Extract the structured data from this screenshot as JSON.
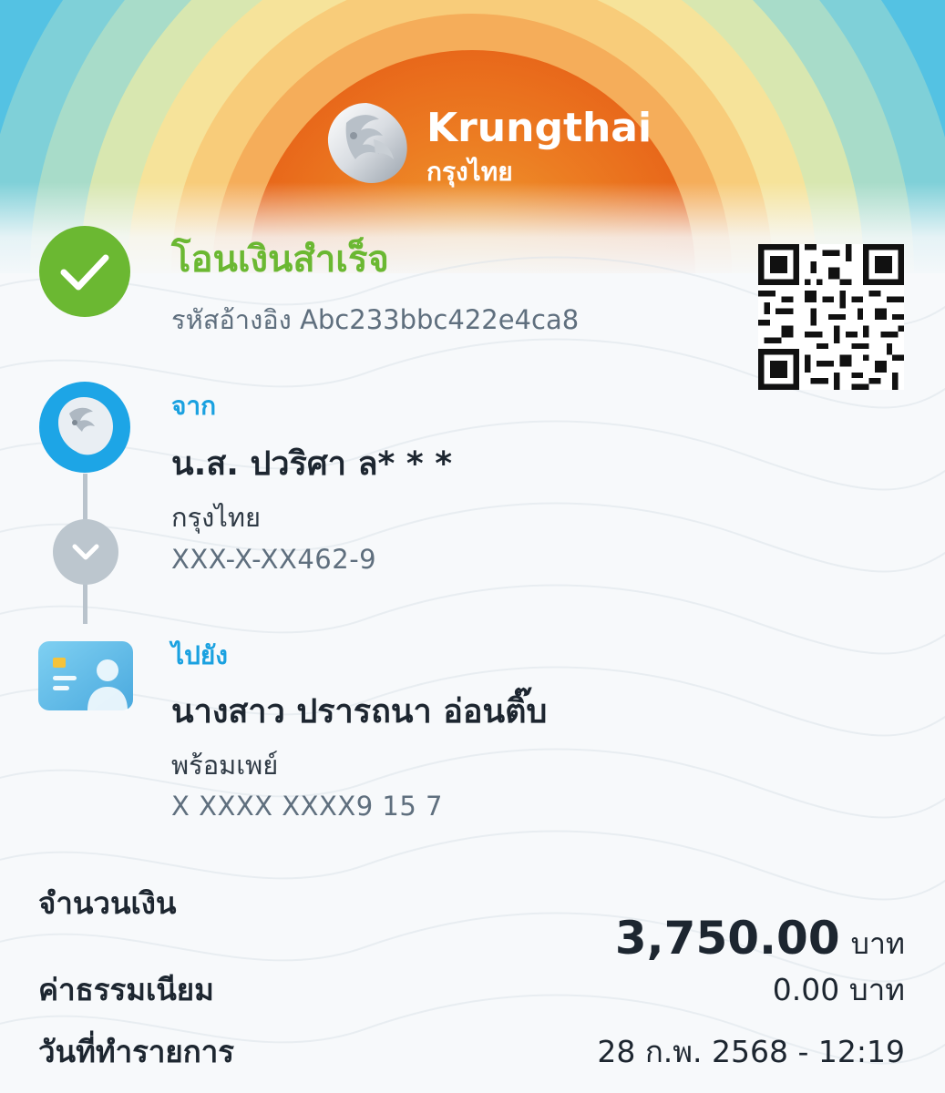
{
  "brand": {
    "name": "Krungthai",
    "thai_name": "กรุงไทย"
  },
  "status": {
    "title": "โอนเงินสำเร็จ",
    "ref_label": "รหัสอ้างอิง",
    "ref_code": "Abc233bbc422e4ca8"
  },
  "from": {
    "label": "จาก",
    "name": "น.ส. ปวริศา ล* * *",
    "bank": "กรุงไทย",
    "account": "XXX-X-XX462-9"
  },
  "to": {
    "label": "ไปยัง",
    "name": "นางสาว ปรารถนา อ่อนติ๊บ",
    "service": "พร้อมเพย์",
    "account": "X XXXX XXXX9 15 7"
  },
  "summary": {
    "amount_label": "จำนวนเงิน",
    "amount_value": "3,750.00",
    "amount_unit": "บาท",
    "fee_label": "ค่าธรรมเนียม",
    "fee_value": "0.00 บาท",
    "date_label": "วันที่ทำรายการ",
    "date_value": "28 ก.พ. 2568 - 12:19"
  },
  "icons": {
    "status": "check-circle-icon",
    "chevron": "chevron-down-icon",
    "receiver": "id-card-icon",
    "qr": "qr-code-icon"
  },
  "colors": {
    "success_green": "#6bb832",
    "section_blue": "#1aa1e0",
    "brand_blue": "#1da5e6"
  }
}
